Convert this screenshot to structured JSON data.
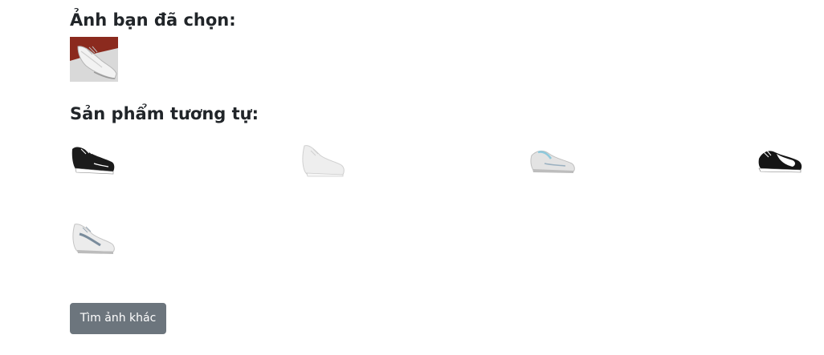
{
  "selected_heading": "Ảnh bạn đã chọn:",
  "similar_heading": "Sản phẩm tương tự:",
  "selected_image": {
    "icon": "white-sneaker-photo-icon",
    "background": "#8b2a1e"
  },
  "results": [
    {
      "icon": "black-sneaker-icon",
      "color": "#1b1b1b"
    },
    {
      "icon": "white-sneaker-icon",
      "color": "#e6e6e6"
    },
    {
      "icon": "white-blue-running-shoe-icon",
      "color": "#dcdcdc",
      "accent": "#8ec9dc"
    },
    {
      "icon": "black-white-golf-shoe-icon",
      "color": "#151515"
    },
    {
      "icon": "white-grey-running-shoe-icon",
      "color": "#e8e8e8",
      "accent": "#7a8c9c"
    }
  ],
  "search_again_button": {
    "label": "Tìm ảnh khác",
    "color": "#6c757d"
  }
}
